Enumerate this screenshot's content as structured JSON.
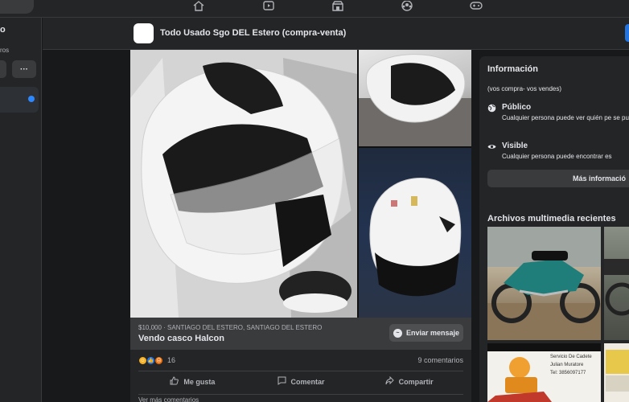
{
  "topnav": {
    "icons": [
      "home-icon",
      "watch-icon",
      "marketplace-icon",
      "groups-icon",
      "gaming-icon"
    ]
  },
  "sidebar": {
    "title": "o",
    "subtitle": "ros",
    "more_label": "···"
  },
  "group": {
    "name": "Todo Usado Sgo DEL Estero (compra-venta)"
  },
  "post": {
    "price_location": "$10,000 · SANTIAGO DEL ESTERO, SANTIAGO DEL ESTERO",
    "title": "Vendo casco Halcon",
    "message_button": "Enviar mensaje",
    "reaction_count": "16",
    "comments_count": "9 comentarios",
    "actions": {
      "like": "Me gusta",
      "comment": "Comentar",
      "share": "Compartir"
    },
    "more_comments": "Ver más comentarios"
  },
  "info": {
    "heading": "Información",
    "description": "(vos compra- vos vendes)",
    "public_title": "Público",
    "public_desc": "Cualquier persona puede ver quién pe se publica.",
    "visible_title": "Visible",
    "visible_desc": "Cualquier persona puede encontrar es",
    "more_button": "Más informació"
  },
  "media": {
    "heading": "Archivos multimedia recientes",
    "thumb3_lines": [
      "Servicio De Cadete",
      "Julian Muratore",
      "Tel: 3856097177"
    ]
  },
  "colors": {
    "background": "#18191a",
    "card": "#242526",
    "accent": "#2d88ff",
    "text": "#e4e6eb",
    "muted": "#b0b3b8"
  }
}
